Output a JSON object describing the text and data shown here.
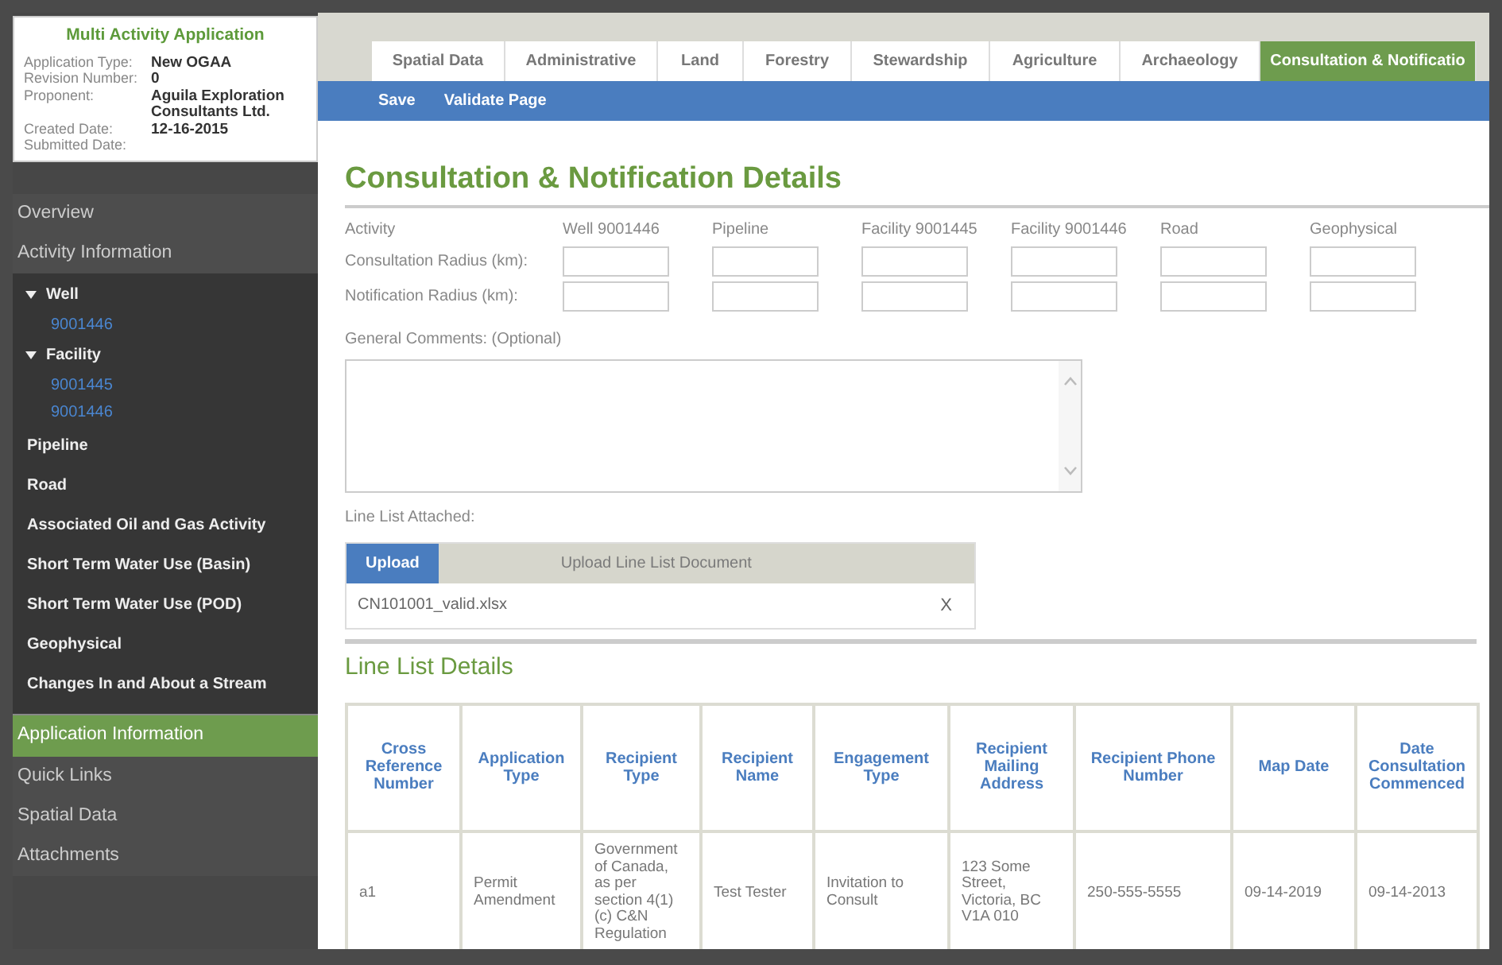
{
  "summary": {
    "title": "Multi Activity Application",
    "fields": [
      {
        "label": "Application Type:",
        "value": "New OGAA"
      },
      {
        "label": "Revision Number:",
        "value": "0"
      },
      {
        "label": "Proponent:",
        "value": "Aguila Exploration Consultants Ltd."
      },
      {
        "label": "Created Date:",
        "value": "12-16-2015"
      },
      {
        "label": "Submitted Date:"
      }
    ]
  },
  "sidebar": {
    "items": [
      {
        "label": "Overview",
        "selected": false
      },
      {
        "label": "Activity Information",
        "selected": false,
        "children": [
          {
            "label": "Well",
            "expanded": true,
            "children": [
              {
                "label": "9001446"
              }
            ]
          },
          {
            "label": "Facility",
            "expanded": true,
            "children": [
              {
                "label": "9001445"
              },
              {
                "label": "9001446"
              }
            ]
          },
          {
            "label": "Pipeline"
          },
          {
            "label": "Road"
          },
          {
            "label": "Associated Oil and Gas Activity"
          },
          {
            "label": "Short Term Water Use (Basin)"
          },
          {
            "label": "Short Term Water Use (POD)"
          },
          {
            "label": "Geophysical"
          },
          {
            "label": "Changes In and About a Stream"
          }
        ]
      },
      {
        "label": "Application Information",
        "selected": true
      },
      {
        "label": "Quick Links",
        "selected": false
      },
      {
        "label": "Spatial Data",
        "selected": false
      },
      {
        "label": "Attachments",
        "selected": false
      }
    ]
  },
  "tabs": [
    {
      "label": "Spatial Data",
      "selected": false
    },
    {
      "label": "Administrative",
      "selected": false
    },
    {
      "label": "Land",
      "selected": false
    },
    {
      "label": "Forestry",
      "selected": false
    },
    {
      "label": "Stewardship",
      "selected": false
    },
    {
      "label": "Agriculture",
      "selected": false
    },
    {
      "label": "Archaeology",
      "selected": false
    },
    {
      "label": "Consultation & Notificatio",
      "selected": true
    }
  ],
  "toolbar": [
    "Save",
    "Validate Page"
  ],
  "form": {
    "title": "Consultation & Notification Details",
    "activity_label": "Activity",
    "activities": [
      "Well 9001446",
      "Pipeline",
      "Facility 9001445",
      "Facility 9001446",
      "Road",
      "Geophysical"
    ],
    "radius_rows": [
      {
        "label": "Consultation Radius (km):"
      },
      {
        "label": "Notification Radius (km):"
      }
    ],
    "comments_label": "General Comments: (Optional)",
    "line_list_label": "Line List Attached:",
    "upload": {
      "button": "Upload",
      "hint": "Upload Line List Document",
      "file": "CN101001_valid.xlsx",
      "remove": "X"
    }
  },
  "line_list": {
    "title": "Line List Details",
    "columns": [
      "Cross Reference Number",
      "Application Type",
      "Recipient Type",
      "Recipient Name",
      "Engagement Type",
      "Recipient Mailing Address",
      "Recipient Phone Number",
      "Map Date",
      "Date Consultation Commenced"
    ],
    "rows": [
      [
        "a1",
        "Permit Amendment",
        "Government of Canada, as per section 4(1) (c) C&N Regulation",
        "Test Tester",
        "Invitation to Consult",
        "123 Some Street, Victoria, BC V1A 010",
        "250-555-5555",
        "09-14-2019",
        "09-14-2013"
      ]
    ]
  }
}
